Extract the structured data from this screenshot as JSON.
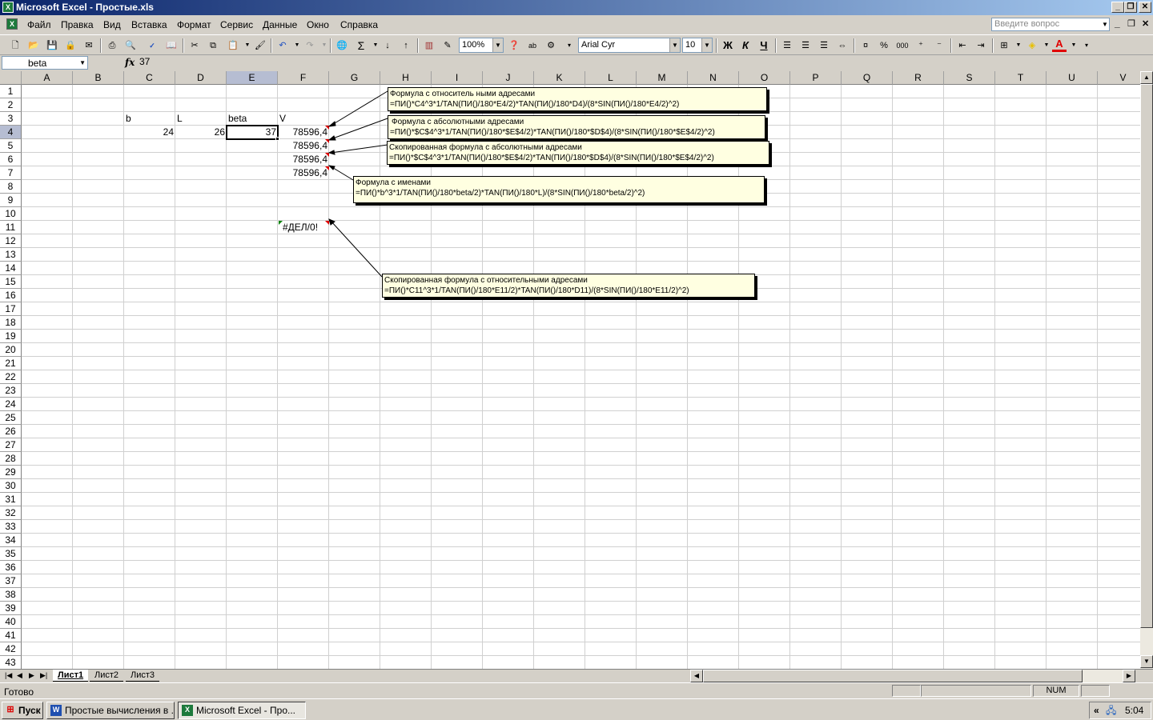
{
  "window": {
    "title": "Microsoft Excel - Простые.xls"
  },
  "menu": {
    "items": [
      "Файл",
      "Правка",
      "Вид",
      "Вставка",
      "Формат",
      "Сервис",
      "Данные",
      "Окно",
      "Справка"
    ],
    "ask_placeholder": "Введите вопрос"
  },
  "toolbar": {
    "zoom": "100%",
    "font": "Arial Cyr",
    "size": "10",
    "bold": "Ж",
    "italic": "К",
    "underline": "Ч",
    "percent": "%",
    "thousands": "000",
    "abc": "ab"
  },
  "formula_bar": {
    "name_box": "beta",
    "fx": "fx",
    "value": "37"
  },
  "columns": [
    "A",
    "B",
    "C",
    "D",
    "E",
    "F",
    "G",
    "H",
    "I",
    "J",
    "K",
    "L",
    "M",
    "N",
    "O",
    "P",
    "Q",
    "R",
    "S",
    "T",
    "U",
    "V"
  ],
  "rows": [
    "1",
    "2",
    "3",
    "4",
    "5",
    "6",
    "7",
    "8",
    "9",
    "10",
    "11",
    "12",
    "13",
    "14",
    "15",
    "16",
    "17",
    "18",
    "19",
    "20",
    "21",
    "22",
    "23",
    "24",
    "25",
    "26",
    "27",
    "28",
    "29",
    "30",
    "31",
    "32",
    "33",
    "34",
    "35",
    "36",
    "37",
    "38",
    "39",
    "40",
    "41",
    "42",
    "43"
  ],
  "cells": {
    "c3": "b",
    "d3": "L",
    "e3": "beta",
    "f3": "V",
    "c4": "24",
    "d4": "26",
    "e4": "37",
    "f4": "78596,4",
    "f5": "78596,4",
    "f6": "78596,4",
    "f7": "78596,4",
    "f11": "#ДЕЛ/0!"
  },
  "comments": [
    {
      "title": "Формула с относитель ными адресами",
      "formula": "=ПИ()*C4^3*1/TAN(ПИ()/180*E4/2)*TAN(ПИ()/180*D4)/(8*SIN(ПИ()/180*E4/2)^2)"
    },
    {
      "title": "Формула с абсолютными адресами",
      "formula": "=ПИ()*$C$4^3*1/TAN(ПИ()/180*$E$4/2)*TAN(ПИ()/180*$D$4)/(8*SIN(ПИ()/180*$E$4/2)^2)"
    },
    {
      "title": "Скопированная формула с абсолютными адресами",
      "formula": "=ПИ()*$C$4^3*1/TAN(ПИ()/180*$E$4/2)*TAN(ПИ()/180*$D$4)/(8*SIN(ПИ()/180*$E$4/2)^2)"
    },
    {
      "title": "Формула с именами",
      "formula": "=ПИ()*b^3*1/TAN(ПИ()/180*beta/2)*TAN(ПИ()/180*L)/(8*SIN(ПИ()/180*beta/2)^2)"
    },
    {
      "title": "Скопированная формула с относительными адресами",
      "formula": "=ПИ()*C11^3*1/TAN(ПИ()/180*E11/2)*TAN(ПИ()/180*D11)/(8*SIN(ПИ()/180*E11/2)^2)"
    }
  ],
  "sheets": [
    "Лист1",
    "Лист2",
    "Лист3"
  ],
  "status": {
    "ready": "Готово",
    "num": "NUM"
  },
  "taskbar": {
    "start": "Пуск",
    "task1": "Простые вычисления в ...",
    "task2": "Microsoft Excel - Про...",
    "clock": "5:04",
    "tray_chevron": "«"
  },
  "icons": {
    "app": "excel-icon",
    "word": "word-icon",
    "start": "windows-flag-icon"
  }
}
